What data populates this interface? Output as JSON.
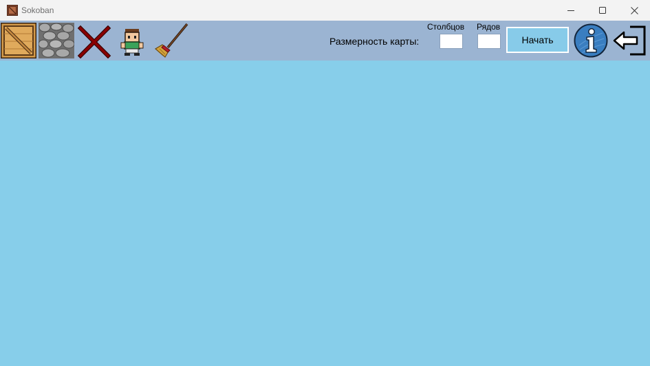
{
  "window": {
    "title": "Sokoban"
  },
  "toolbar": {
    "tools": [
      {
        "name": "box",
        "icon": "wooden-crate-icon"
      },
      {
        "name": "wall",
        "icon": "stone-wall-icon"
      },
      {
        "name": "delete",
        "icon": "red-cross-icon"
      },
      {
        "name": "player",
        "icon": "player-character-icon"
      },
      {
        "name": "clear",
        "icon": "broom-icon"
      }
    ],
    "map_size_label": "Размерность карты:",
    "columns_label": "Столбцов",
    "rows_label": "Рядов",
    "columns_value": "",
    "rows_value": "",
    "start_label": "Начать",
    "info_icon": "info-icon",
    "exit_icon": "exit-arrow-icon"
  },
  "colors": {
    "titlebar_bg": "#f3f3f3",
    "toolbar_bg": "#9bb4d2",
    "map_bg": "#87ceea",
    "start_button_bg": "#87cbe9"
  }
}
